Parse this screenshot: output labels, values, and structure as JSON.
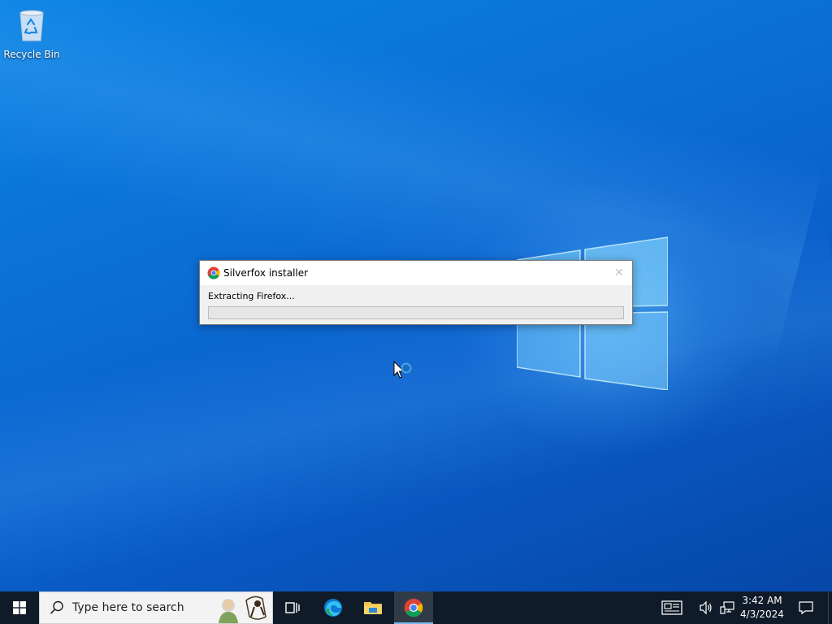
{
  "desktop": {
    "icons": [
      {
        "label": "Recycle Bin",
        "icon": "recycle-bin-icon"
      }
    ]
  },
  "dialog": {
    "title": "Silverfox installer",
    "app_icon": "chrome-icon",
    "close_symbol": "✕",
    "status": "Extracting Firefox...",
    "progress": 0
  },
  "taskbar": {
    "start_icon": "windows-start-icon",
    "search_placeholder": "Type here to search",
    "pinned": [
      {
        "name": "task-view",
        "icon": "task-view-icon"
      },
      {
        "name": "edge",
        "icon": "edge-icon"
      },
      {
        "name": "file-explorer",
        "icon": "folder-icon"
      },
      {
        "name": "chrome",
        "icon": "chrome-icon",
        "active": true
      }
    ],
    "tray": {
      "icons": [
        "news-icon",
        "volume-icon",
        "network-icon"
      ],
      "time": "3:42 AM",
      "date": "4/3/2024"
    }
  },
  "colors": {
    "taskbar_bg": "#101b29",
    "desktop_blue": "#0a6fd6",
    "progress_green": "#06b025",
    "accent": "#76b9ed"
  }
}
